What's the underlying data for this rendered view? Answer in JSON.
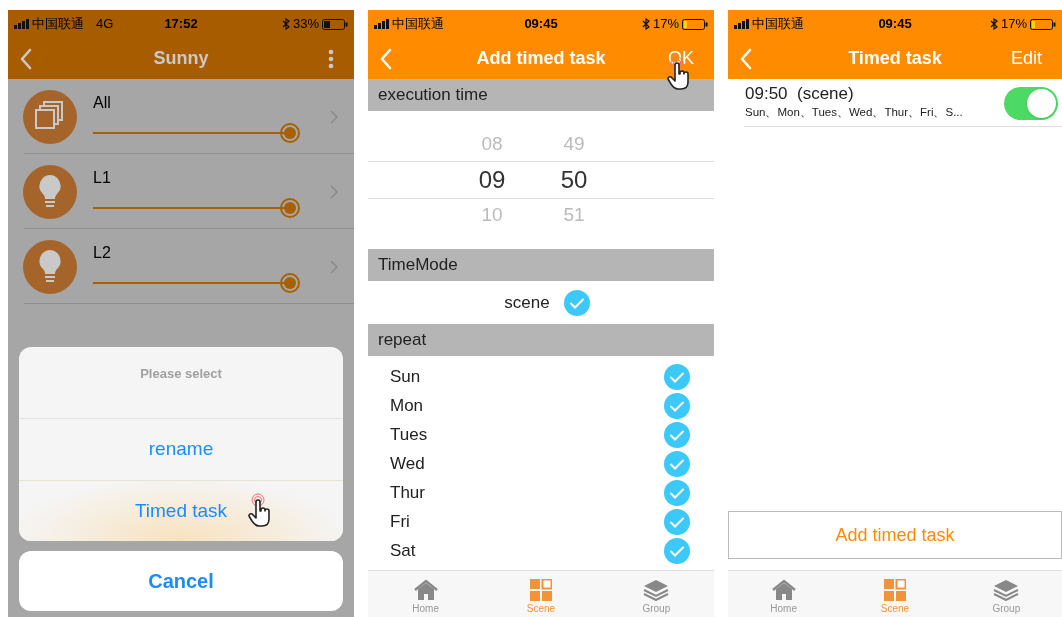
{
  "screens": [
    {
      "kind": "device_list",
      "status_bar": {
        "carrier": "中国联通",
        "network": "4G",
        "time": "17:52",
        "battery": "33%",
        "low_battery": false
      },
      "nav": {
        "title": "Sunny",
        "right": {
          "kind": "menu"
        }
      },
      "rows": [
        {
          "name": "All",
          "kind": "group",
          "level": 0.95
        },
        {
          "name": "L1",
          "kind": "bulb",
          "level": 0.95
        },
        {
          "name": "L2",
          "kind": "bulb",
          "level": 0.95
        }
      ],
      "action_sheet": {
        "title": "Please select",
        "options": [
          {
            "label": "rename",
            "touched": false
          },
          {
            "label": "Timed task",
            "touched": true
          }
        ],
        "cancel": "Cancel"
      }
    },
    {
      "kind": "add_task",
      "status_bar": {
        "carrier": "中国联通",
        "time": "09:45",
        "battery": "17%",
        "low_battery": true
      },
      "nav": {
        "title": "Add timed task",
        "right": {
          "kind": "text",
          "label": "OK",
          "touched": true
        }
      },
      "sections": [
        {
          "kind": "picker",
          "title": "execution time",
          "columns": [
            {
              "items": [
                {
                  "text": "08",
                  "selected": false
                },
                {
                  "text": "09",
                  "selected": true
                },
                {
                  "text": "10",
                  "selected": false
                }
              ]
            },
            {
              "items": [
                {
                  "text": "49",
                  "selected": false
                },
                {
                  "text": "50",
                  "selected": true
                },
                {
                  "text": "51",
                  "selected": false
                }
              ]
            }
          ]
        },
        {
          "kind": "mode",
          "title": "TimeMode",
          "options": [
            {
              "label": "scene",
              "checked": true
            }
          ]
        },
        {
          "kind": "days",
          "title": "repeat",
          "days": [
            {
              "label": "Sun",
              "checked": true
            },
            {
              "label": "Mon",
              "checked": true
            },
            {
              "label": "Tues",
              "checked": true
            },
            {
              "label": "Wed",
              "checked": true
            },
            {
              "label": "Thur",
              "checked": true
            },
            {
              "label": "Fri",
              "checked": true
            },
            {
              "label": "Sat",
              "checked": true
            }
          ]
        }
      ],
      "tab_bar": [
        {
          "label": "Home",
          "selected": false
        },
        {
          "label": "Scene",
          "selected": true
        },
        {
          "label": "Group",
          "selected": false
        }
      ]
    },
    {
      "kind": "task_list",
      "status_bar": {
        "carrier": "中国联通",
        "time": "09:45",
        "battery": "17%",
        "low_battery": true
      },
      "nav": {
        "title": "Timed task",
        "right": {
          "kind": "text",
          "label": "Edit",
          "touched": false
        }
      },
      "tasks": [
        {
          "title": "09:50  (scene)",
          "days": "Sun、Mon、Tues、Wed、Thur、Fri、S...",
          "on": true
        }
      ],
      "add_button": "Add timed task",
      "tab_bar": [
        {
          "label": "Home",
          "selected": false
        },
        {
          "label": "Scene",
          "selected": true
        },
        {
          "label": "Group",
          "selected": false
        }
      ]
    }
  ]
}
